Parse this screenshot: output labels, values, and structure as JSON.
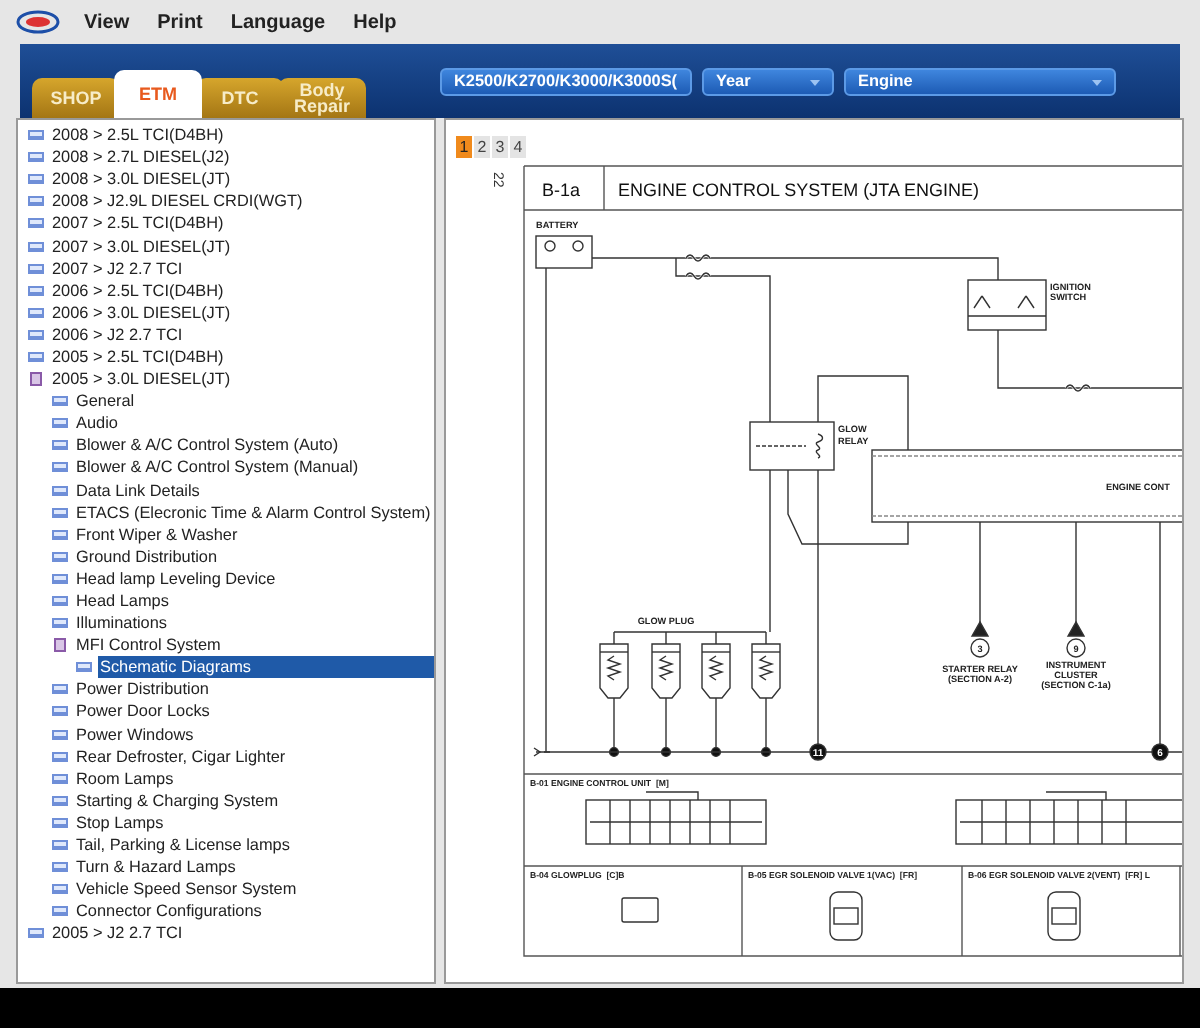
{
  "menu": [
    "View",
    "Print",
    "Language",
    "Help"
  ],
  "tabs": [
    {
      "label": "SHOP",
      "selected": false
    },
    {
      "label": "ETM",
      "selected": true
    },
    {
      "label": "DTC",
      "selected": false
    },
    {
      "label": "Body Repair",
      "selected": false
    }
  ],
  "selectors": [
    {
      "value": "K2500/K2700/K3000/K3000S("
    },
    {
      "value": "Year",
      "arrow": true
    },
    {
      "value": "Engine",
      "arrow": true
    }
  ],
  "tree": [
    {
      "label": "2008 > 2.5L TCI(D4BH)",
      "expanded": false,
      "selected": false
    },
    {
      "label": "2008 > 2.7L DIESEL(J2)",
      "expanded": false,
      "selected": false
    },
    {
      "label": "2008 > 3.0L DIESEL(JT)",
      "expanded": false,
      "selected": false
    },
    {
      "label": "2008 > J2.9L DIESEL CRDI(WGT)",
      "expanded": false,
      "selected": false
    },
    {
      "label": "2007 > 2.5L TCI(D4BH)",
      "expanded": false,
      "selected": false
    },
    {
      "label": "2007 > 3.0L DIESEL(JT)",
      "expanded": false,
      "selected": false
    },
    {
      "label": "2007 > J2 2.7 TCI",
      "expanded": false,
      "selected": false
    },
    {
      "label": "2006 > 2.5L TCI(D4BH)",
      "expanded": false,
      "selected": false
    },
    {
      "label": "2006 > 3.0L DIESEL(JT)",
      "expanded": false,
      "selected": false
    },
    {
      "label": "2006 > J2 2.7 TCI",
      "expanded": false,
      "selected": false
    },
    {
      "label": "2005 > 2.5L TCI(D4BH)",
      "expanded": false,
      "selected": false
    },
    {
      "label": "2005 > 3.0L DIESEL(JT)",
      "expanded": true,
      "selected": false,
      "children": [
        {
          "label": "General",
          "expanded": false,
          "selected": false
        },
        {
          "label": "Audio",
          "expanded": false,
          "selected": false
        },
        {
          "label": "Blower & A/C Control System (Auto)",
          "expanded": false,
          "selected": false
        },
        {
          "label": "Blower & A/C Control System (Manual)",
          "expanded": false,
          "selected": false
        },
        {
          "label": "Data Link Details",
          "expanded": false,
          "selected": false
        },
        {
          "label": "ETACS (Elecronic Time & Alarm Control System)",
          "expanded": false,
          "selected": false
        },
        {
          "label": "Front Wiper & Washer",
          "expanded": false,
          "selected": false
        },
        {
          "label": "Ground Distribution",
          "expanded": false,
          "selected": false
        },
        {
          "label": "Head lamp Leveling Device",
          "expanded": false,
          "selected": false
        },
        {
          "label": "Head Lamps",
          "expanded": false,
          "selected": false
        },
        {
          "label": "Illuminations",
          "expanded": false,
          "selected": false
        },
        {
          "label": "MFI Control System",
          "expanded": true,
          "selected": false,
          "children": [
            {
              "label": "Schematic Diagrams",
              "expanded": false,
              "selected": true
            }
          ]
        },
        {
          "label": "Power Distribution",
          "expanded": false,
          "selected": false
        },
        {
          "label": "Power Door Locks",
          "expanded": false,
          "selected": false
        },
        {
          "label": "Power Windows",
          "expanded": false,
          "selected": false
        },
        {
          "label": "Rear Defroster, Cigar Lighter",
          "expanded": false,
          "selected": false
        },
        {
          "label": "Room Lamps",
          "expanded": false,
          "selected": false
        },
        {
          "label": "Starting & Charging System",
          "expanded": false,
          "selected": false
        },
        {
          "label": "Stop Lamps",
          "expanded": false,
          "selected": false
        },
        {
          "label": "Tail, Parking & License lamps",
          "expanded": false,
          "selected": false
        },
        {
          "label": "Turn & Hazard Lamps",
          "expanded": false,
          "selected": false
        },
        {
          "label": "Vehicle Speed Sensor System",
          "expanded": false,
          "selected": false
        },
        {
          "label": "Connector Configurations",
          "expanded": false,
          "selected": false
        }
      ]
    },
    {
      "label": "2005 > J2 2.7 TCI",
      "expanded": false,
      "selected": false
    }
  ],
  "pages": [
    {
      "label": "1",
      "selected": true
    },
    {
      "label": "2",
      "selected": false
    },
    {
      "label": "3",
      "selected": false
    },
    {
      "label": "4",
      "selected": false
    }
  ],
  "diagram": {
    "page_number": "22",
    "section": "B-1a",
    "title": "ENGINE CONTROL SYSTEM (JTA ENGINE)",
    "labels": [
      {
        "text": "BATTERY"
      },
      {
        "text": "IGNITION"
      },
      {
        "text": "SWITCH"
      },
      {
        "text": "GLOW"
      },
      {
        "text": "RELAY"
      },
      {
        "text": "ENGINE CONT"
      },
      {
        "text": "GLOW PLUG"
      },
      {
        "text": "3"
      },
      {
        "text": "STARTER RELAY"
      },
      {
        "text": "(SECTION A-2)"
      },
      {
        "text": "9"
      },
      {
        "text": "INSTRUMENT"
      },
      {
        "text": "CLUSTER"
      },
      {
        "text": "(SECTION C-1a)"
      },
      {
        "text": "11"
      },
      {
        "text": "6"
      }
    ],
    "connectors": [
      {
        "text": "B-01 ENGINE CONTROL UNIT  [M]"
      },
      {
        "text": "B-04 GLOWPLUG  [C]B"
      },
      {
        "text": "B-05 EGR SOLENOID VALVE 1(VAC)  [FR]"
      },
      {
        "text": "B-06 EGR SOLENOID VALVE 2(VENT)  [FR] L"
      }
    ]
  }
}
